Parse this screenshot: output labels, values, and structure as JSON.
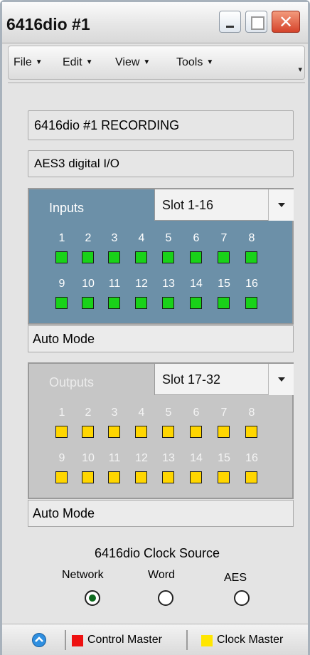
{
  "window": {
    "title": "6416dio #1"
  },
  "menu": [
    {
      "label": "File"
    },
    {
      "label": "Edit"
    },
    {
      "label": "View"
    },
    {
      "label": "Tools"
    }
  ],
  "device": {
    "title": "6416dio #1 RECORDING",
    "io_type": "AES3 digital I/O"
  },
  "inputs": {
    "label": "Inputs",
    "slot": "Slot 1-16",
    "led_color": "#19d219",
    "channels_row1": [
      "1",
      "2",
      "3",
      "4",
      "5",
      "6",
      "7",
      "8"
    ],
    "channels_row2": [
      "9",
      "10",
      "11",
      "12",
      "13",
      "14",
      "15",
      "16"
    ],
    "mode": "Auto Mode"
  },
  "outputs": {
    "label": "Outputs",
    "slot": "Slot 17-32",
    "led_color": "#ffd600",
    "channels_row1": [
      "1",
      "2",
      "3",
      "4",
      "5",
      "6",
      "7",
      "8"
    ],
    "channels_row2": [
      "9",
      "10",
      "11",
      "12",
      "13",
      "14",
      "15",
      "16"
    ],
    "mode": "Auto Mode"
  },
  "clock": {
    "title": "6416dio Clock Source",
    "options": [
      {
        "label": "Network",
        "selected": true
      },
      {
        "label": "Word",
        "selected": false
      },
      {
        "label": "AES",
        "selected": false
      }
    ]
  },
  "status": {
    "control_master": {
      "label": "Control Master",
      "color": "#ee1111"
    },
    "clock_master": {
      "label": "Clock Master",
      "color": "#ffe600"
    }
  }
}
